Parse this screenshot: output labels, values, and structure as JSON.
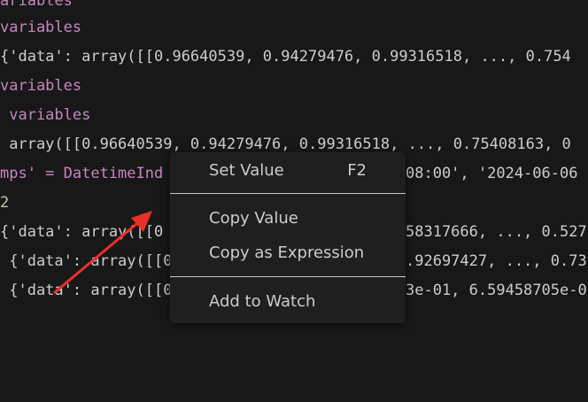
{
  "editor": {
    "lines": [
      {
        "a": "ariables",
        "b": ""
      },
      {
        "a": "variables",
        "b": ""
      },
      {
        "a": "{'data': array([[0.96640539, 0.94279476, 0.99316518, ..., 0.754",
        "b": ""
      },
      {
        "a": "variables",
        "b": ""
      },
      {
        "a": " variables",
        "b": ""
      },
      {
        "a": " array([[0.96640539, 0.94279476, 0.99316518, ..., 0.75408163, 0",
        "b": ""
      },
      {
        "a": "mps' = DatetimeInd",
        "b": "08:00', '2024-06-06"
      },
      {
        "a": "2",
        "b": ""
      },
      {
        "a": "{'data': array([[0",
        "b": "58317666, ..., 0.527"
      },
      {
        "a": " {'data': array([[0",
        "b": ".92697427, ..., 0.73"
      },
      {
        "a": " {'data': array([[0",
        "b": "3e-01, 6.59458705e-0"
      }
    ]
  },
  "context_menu": {
    "set_value": "Set Value",
    "set_value_shortcut": "F2",
    "copy_value": "Copy Value",
    "copy_as_expression": "Copy as Expression",
    "add_to_watch": "Add to Watch"
  },
  "colors": {
    "background": "#181818",
    "menu_background": "#1f1f1f",
    "keyword": "#c586c0",
    "text": "#cccccc",
    "arrow": "#e8302a"
  }
}
